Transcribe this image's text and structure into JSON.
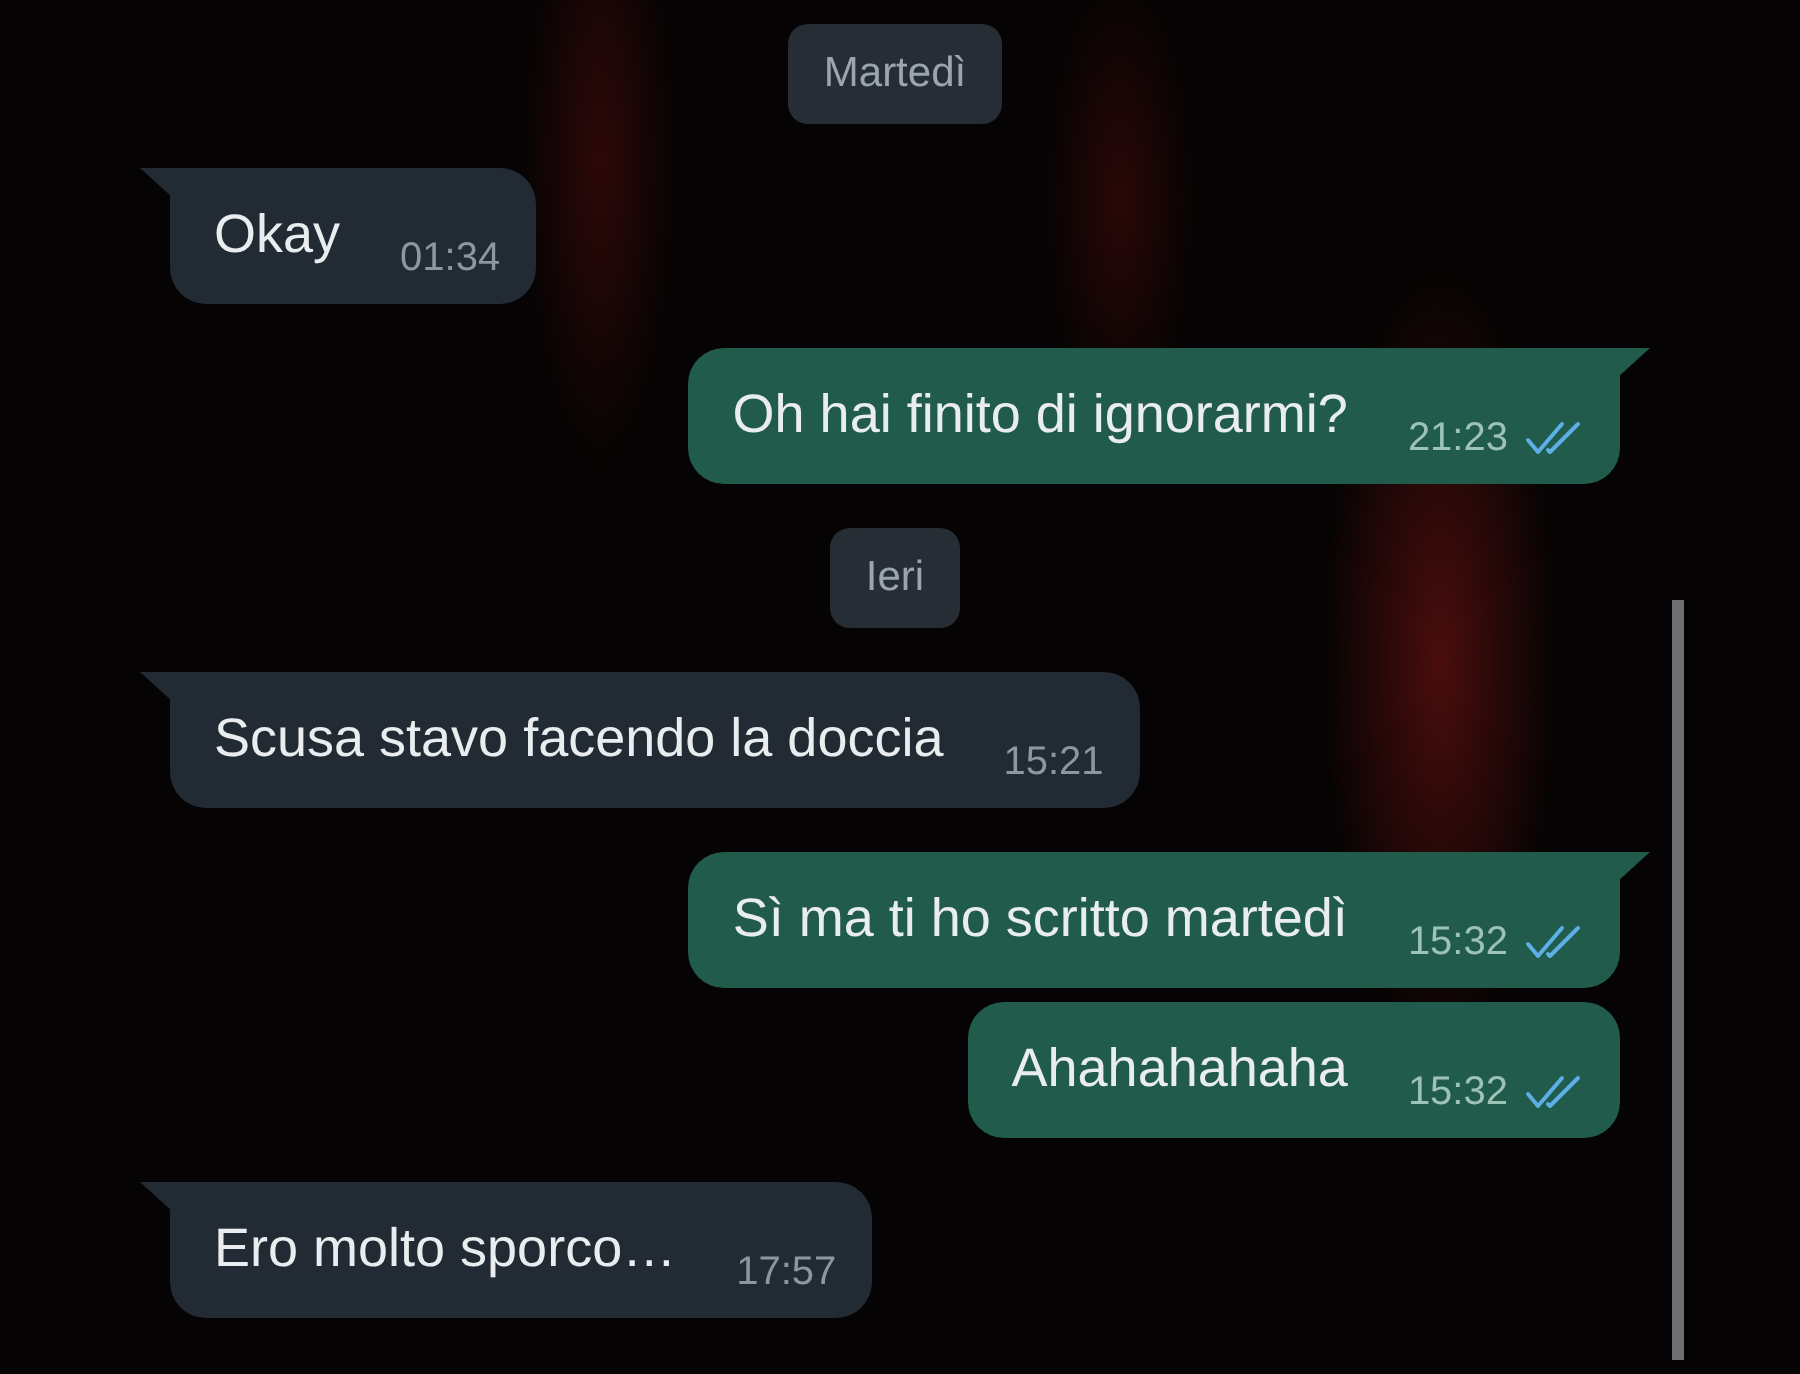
{
  "messages": [
    {
      "kind": "date",
      "text": "Martedì"
    },
    {
      "kind": "incoming",
      "text": "Okay",
      "time": "01:34",
      "tail": true
    },
    {
      "kind": "outgoing",
      "text": "Oh hai finito di ignorarmi?",
      "time": "21:23",
      "tail": true,
      "read": true
    },
    {
      "kind": "date",
      "text": "Ieri"
    },
    {
      "kind": "incoming",
      "text": "Scusa stavo facendo la doccia",
      "time": "15:21",
      "tail": true
    },
    {
      "kind": "outgoing",
      "text": "Sì ma ti ho scritto martedì",
      "time": "15:32",
      "tail": true,
      "read": true
    },
    {
      "kind": "outgoing",
      "text": "Ahahahahaha",
      "time": "15:32",
      "tail": false,
      "read": true
    },
    {
      "kind": "incoming",
      "text": "Ero molto sporco…",
      "time": "17:57",
      "tail": true
    }
  ]
}
